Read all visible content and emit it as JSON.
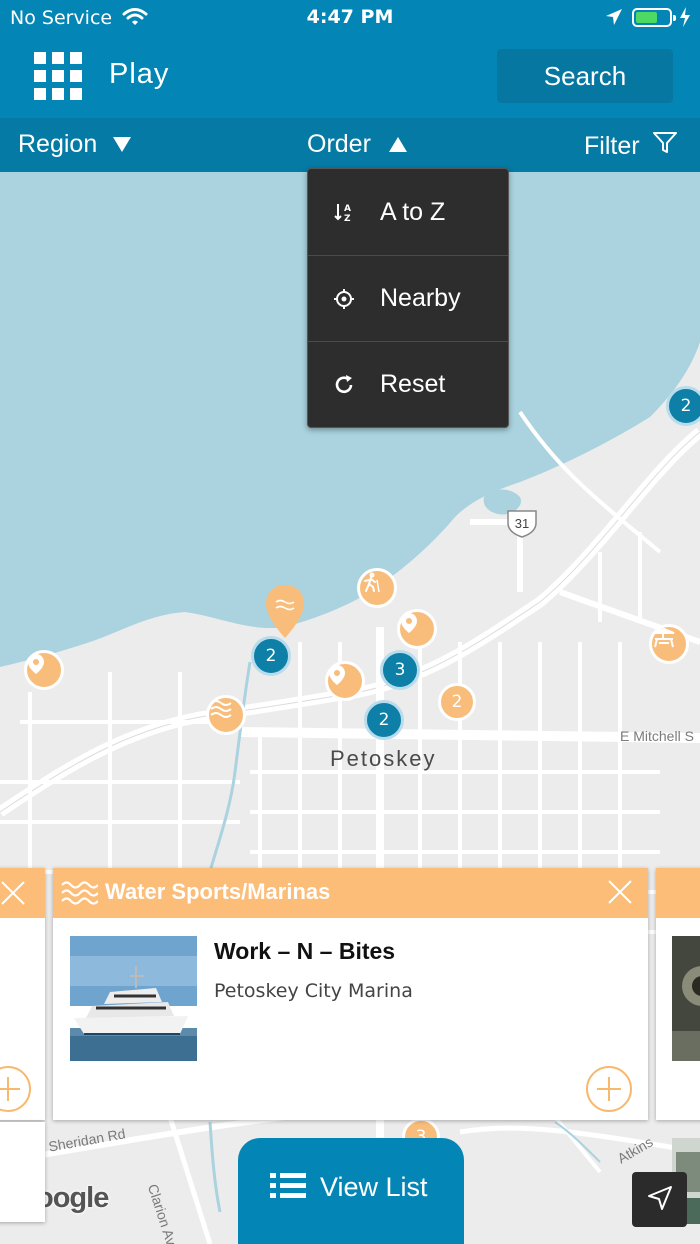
{
  "status_bar": {
    "carrier": "No Service",
    "time": "4:47 PM",
    "battery_level": 0.65,
    "battery_color": "#4cd964"
  },
  "header": {
    "title": "Play",
    "menu_icon": "grid-icon",
    "search_label": "Search",
    "background": "#0386b6"
  },
  "filter_bar": {
    "region_label": "Region",
    "order_label": "Order",
    "filter_label": "Filter"
  },
  "order_menu": {
    "items": [
      {
        "label": "A to Z",
        "icon": "sort-az-icon"
      },
      {
        "label": "Nearby",
        "icon": "crosshair-icon"
      },
      {
        "label": "Reset",
        "icon": "refresh-icon"
      }
    ]
  },
  "map": {
    "city": "Petoskey",
    "highway_shield": "31",
    "street_labels": [
      "E Mitchell S",
      "Sheridan Rd",
      "Clarion Ave",
      "Atkins"
    ],
    "attribution": "oogle",
    "clusters_blue": [
      "2",
      "2",
      "3",
      "2"
    ],
    "clusters_orange": [
      "2",
      "3"
    ],
    "water_color": "#aad3df",
    "land_color": "#ececec"
  },
  "card": {
    "category": "Water Sports/Marinas",
    "category_icon": "waves-icon",
    "name": "Work – N – Bites",
    "location": "Petoskey City Marina",
    "accent": "#fbbd78"
  },
  "view_list": {
    "label": "View List",
    "icon": "list-icon"
  }
}
